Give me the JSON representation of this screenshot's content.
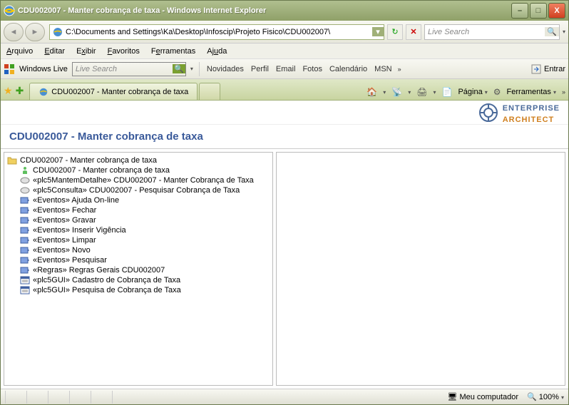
{
  "title": "CDU002007 - Manter cobrança de taxa - Windows Internet Explorer",
  "address": "C:\\Documents and Settings\\Ka\\Desktop\\Infoscip\\Projeto Fisico\\CDU002007\\",
  "live_search_placeholder": "Live Search",
  "menus": {
    "arquivo": "Arquivo",
    "editar": "Editar",
    "exibir": "Exibir",
    "favoritos": "Favoritos",
    "ferramentas": "Ferramentas",
    "ajuda": "Ajuda"
  },
  "windows_live": "Windows Live",
  "live_search2": "Live Search",
  "tb_links": {
    "novidades": "Novidades",
    "perfil": "Perfil",
    "email": "Email",
    "fotos": "Fotos",
    "calendario": "Calendário",
    "msn": "MSN"
  },
  "entrar": "Entrar",
  "tab_title": "CDU002007 - Manter cobrança de taxa",
  "pagina": "Página",
  "ferramentas_btn": "Ferramentas",
  "ea": {
    "ent": "ENTERPRISE",
    "arch": "ARCHITECT"
  },
  "page_heading": "CDU002007 - Manter cobrança de taxa",
  "tree": [
    {
      "icon": "folder",
      "label": "CDU002007 - Manter cobrança de taxa",
      "root": true
    },
    {
      "icon": "actor",
      "label": "CDU002007 - Manter cobrança de taxa"
    },
    {
      "icon": "usecase",
      "label": "«plc5MantemDetalhe» CDU002007 - Manter Cobrança de Taxa"
    },
    {
      "icon": "usecase",
      "label": "«plc5Consulta» CDU002007 - Pesquisar Cobrança de Taxa"
    },
    {
      "icon": "event",
      "label": "«Eventos» Ajuda On-line"
    },
    {
      "icon": "event",
      "label": "«Eventos» Fechar"
    },
    {
      "icon": "event",
      "label": "«Eventos» Gravar"
    },
    {
      "icon": "event",
      "label": "«Eventos» Inserir Vigência"
    },
    {
      "icon": "event",
      "label": "«Eventos» Limpar"
    },
    {
      "icon": "event",
      "label": "«Eventos» Novo"
    },
    {
      "icon": "event",
      "label": "«Eventos» Pesquisar"
    },
    {
      "icon": "event",
      "label": "«Regras» Regras  Gerais CDU002007"
    },
    {
      "icon": "gui",
      "label": "«plc5GUI» Cadastro de Cobrança de Taxa"
    },
    {
      "icon": "gui",
      "label": "«plc5GUI» Pesquisa de Cobrança de Taxa"
    }
  ],
  "status": {
    "computer": "Meu computador",
    "zoom": "100%"
  }
}
